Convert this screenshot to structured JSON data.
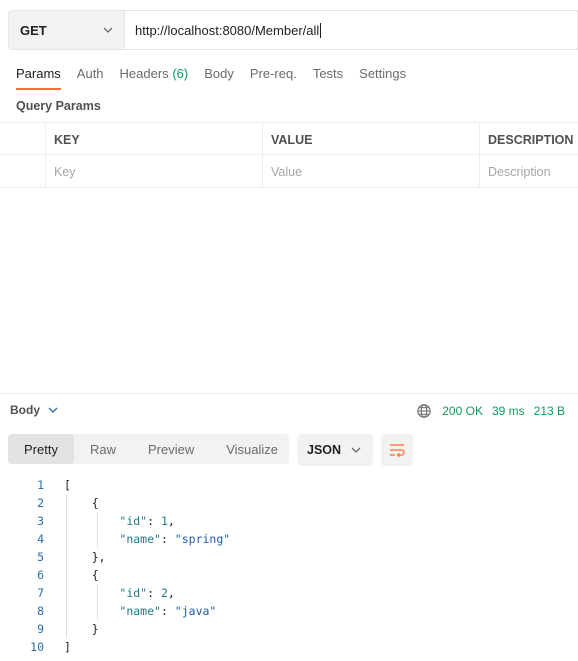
{
  "request": {
    "method": "GET",
    "url": "http://localhost:8080/Member/all"
  },
  "tabs": [
    {
      "label": "Params"
    },
    {
      "label": "Auth"
    },
    {
      "label": "Headers",
      "count": "(6)"
    },
    {
      "label": "Body"
    },
    {
      "label": "Pre-req."
    },
    {
      "label": "Tests"
    },
    {
      "label": "Settings"
    }
  ],
  "query_params": {
    "title": "Query Params",
    "headers": [
      "KEY",
      "VALUE",
      "DESCRIPTION"
    ],
    "placeholders": [
      "Key",
      "Value",
      "Description"
    ]
  },
  "response": {
    "body_label": "Body",
    "status": "200 OK",
    "time": "39 ms",
    "size": "213 B",
    "formats": [
      "Pretty",
      "Raw",
      "Preview",
      "Visualize"
    ],
    "active_format": "Pretty",
    "language": "JSON"
  },
  "code_lines": [
    {
      "n": "1",
      "text": "["
    },
    {
      "n": "2",
      "text": "    {"
    },
    {
      "n": "3",
      "text": "        \"id\": 1,"
    },
    {
      "n": "4",
      "text": "        \"name\": \"spring\""
    },
    {
      "n": "5",
      "text": "    },"
    },
    {
      "n": "6",
      "text": "    {"
    },
    {
      "n": "7",
      "text": "        \"id\": 2,"
    },
    {
      "n": "8",
      "text": "        \"name\": \"java\""
    },
    {
      "n": "9",
      "text": "    }"
    },
    {
      "n": "10",
      "text": "]"
    }
  ],
  "colors": {
    "accent": "#ff6c37",
    "success": "#0e9c5e"
  },
  "icons": {
    "method_dropdown": "chevron-down-icon",
    "body_dropdown": "chevron-down-icon",
    "network": "globe-icon",
    "wrap": "wrap-lines-icon"
  }
}
